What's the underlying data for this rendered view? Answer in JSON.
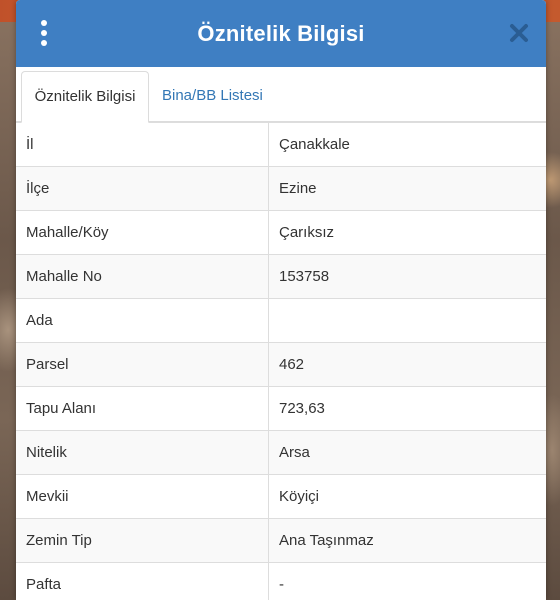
{
  "dialog": {
    "title": "Öznitelik Bilgisi",
    "accent_color": "#3f7fc3",
    "menu_icon": "kebab-menu-icon",
    "close_icon": "close-icon"
  },
  "tabs": [
    {
      "label": "Öznitelik Bilgisi",
      "active": true
    },
    {
      "label": "Bina/BB Listesi",
      "active": false
    }
  ],
  "attributes": [
    {
      "key": "İl",
      "value": "Çanakkale"
    },
    {
      "key": "İlçe",
      "value": "Ezine"
    },
    {
      "key": "Mahalle/Köy",
      "value": "Çarıksız"
    },
    {
      "key": "Mahalle No",
      "value": "153758"
    },
    {
      "key": "Ada",
      "value": ""
    },
    {
      "key": "Parsel",
      "value": "462"
    },
    {
      "key": "Tapu Alanı",
      "value": "723,63"
    },
    {
      "key": "Nitelik",
      "value": "Arsa"
    },
    {
      "key": "Mevkii",
      "value": "Köyiçi"
    },
    {
      "key": "Zemin Tip",
      "value": "Ana Taşınmaz"
    },
    {
      "key": "Pafta",
      "value": "-"
    }
  ]
}
